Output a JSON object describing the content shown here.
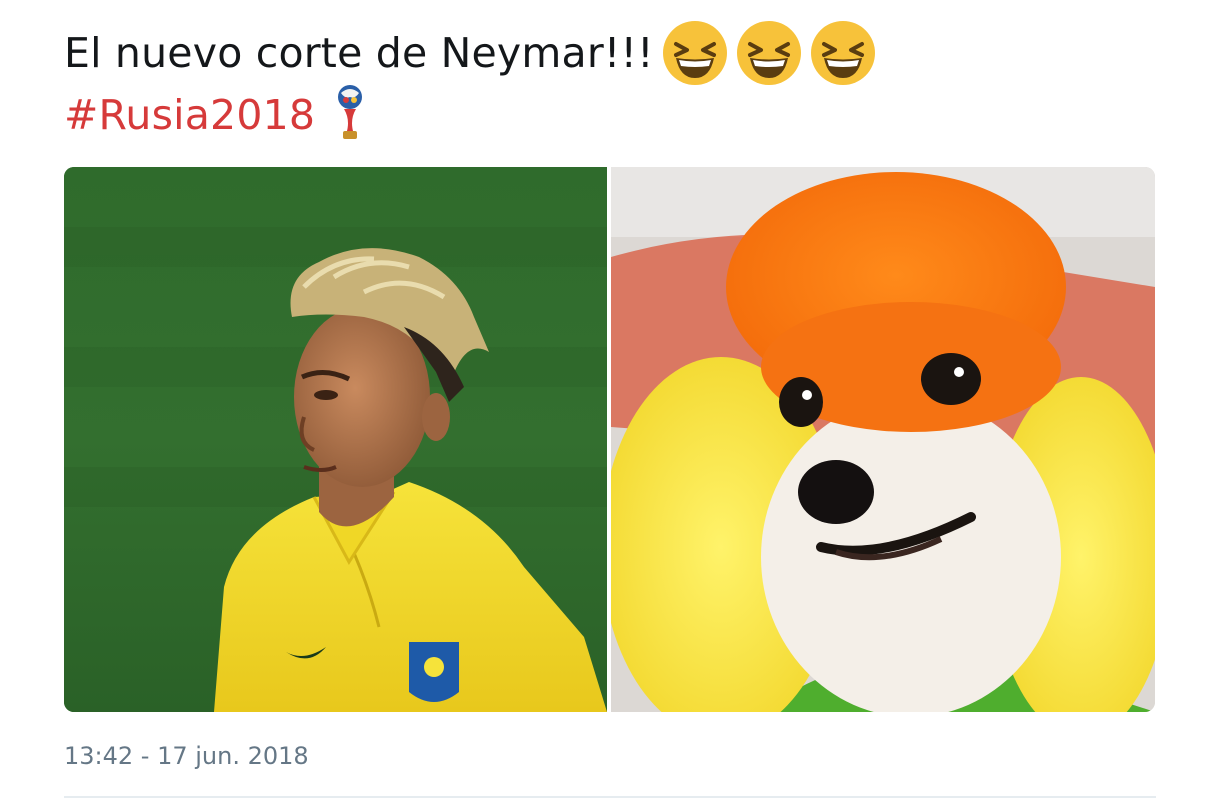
{
  "tweet": {
    "text": "El nuevo corte de Neymar!!!",
    "emojis": [
      "grinning-squinting-face",
      "grinning-squinting-face",
      "grinning-squinting-face"
    ],
    "hashtag": "#Rusia2018",
    "hashtag_emoji": "world-cup-trophy",
    "timestamp": "13:42 - 17 jun. 2018"
  },
  "media": {
    "images": [
      {
        "subject": "footballer-yellow-jersey-bleached-hair"
      },
      {
        "subject": "poodle-orange-yellow-dyed-fur"
      }
    ]
  },
  "colors": {
    "hashtag": "#d63a3a",
    "text": "#14171a",
    "timestamp": "#657786",
    "emoji": "#f7c23a"
  }
}
